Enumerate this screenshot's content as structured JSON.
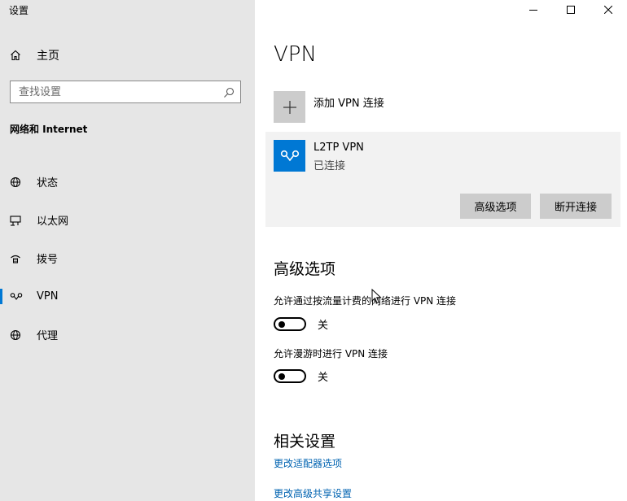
{
  "app": {
    "title": "设置"
  },
  "sidebar": {
    "home_label": "主页",
    "search_placeholder": "查找设置",
    "section_heading": "网络和 Internet",
    "items": [
      {
        "label": "状态",
        "icon": "globe-status-icon"
      },
      {
        "label": "以太网",
        "icon": "ethernet-icon"
      },
      {
        "label": "拨号",
        "icon": "dialup-icon"
      },
      {
        "label": "VPN",
        "icon": "vpn-icon",
        "active": true
      },
      {
        "label": "代理",
        "icon": "proxy-globe-icon"
      }
    ]
  },
  "window_controls": {
    "minimize": "—",
    "maximize": "☐",
    "close": "✕"
  },
  "main": {
    "title": "VPN",
    "add_vpn_label": "添加 VPN 连接",
    "vpn": {
      "name": "L2TP VPN",
      "status": "已连接",
      "advanced_button": "高级选项",
      "disconnect_button": "断开连接"
    },
    "advanced": {
      "heading": "高级选项",
      "options": [
        {
          "label": "允许通过按流量计费的网络进行 VPN 连接",
          "state": "关",
          "on": false
        },
        {
          "label": "允许漫游时进行 VPN 连接",
          "state": "关",
          "on": false
        }
      ]
    },
    "related": {
      "heading": "相关设置",
      "links": [
        "更改适配器选项",
        "更改高级共享设置"
      ]
    }
  },
  "colors": {
    "accent": "#0078d4",
    "sidebar_bg": "#e6e6e6",
    "card_bg": "#f2f2f2",
    "link": "#0063b1"
  }
}
